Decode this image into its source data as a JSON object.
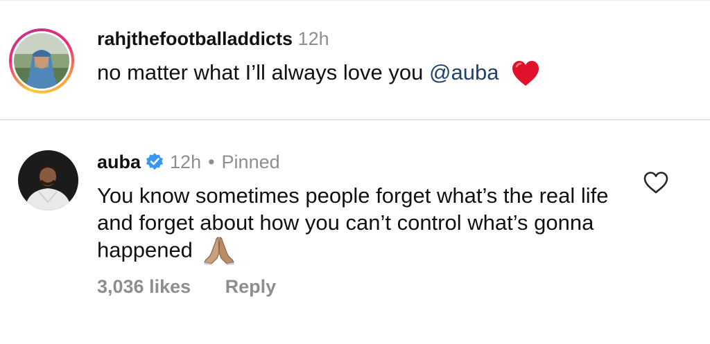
{
  "comments": [
    {
      "username": "rahjthefootballaddicts",
      "time": "12h",
      "text_before": "no matter what I’ll always love you ",
      "mention": "@auba",
      "emoji": "red-heart"
    },
    {
      "username": "auba",
      "verified": true,
      "time": "12h",
      "separator": "•",
      "pinned_label": "Pinned",
      "text": "You know sometimes people forget what’s the real life and forget about how you can’t control what’s gonna happened",
      "emoji": "folded-hands",
      "likes": "3,036 likes",
      "reply_label": "Reply"
    }
  ],
  "colors": {
    "mention": "#20426b",
    "verified": "#3897f0",
    "muted": "#8e8e8e"
  }
}
